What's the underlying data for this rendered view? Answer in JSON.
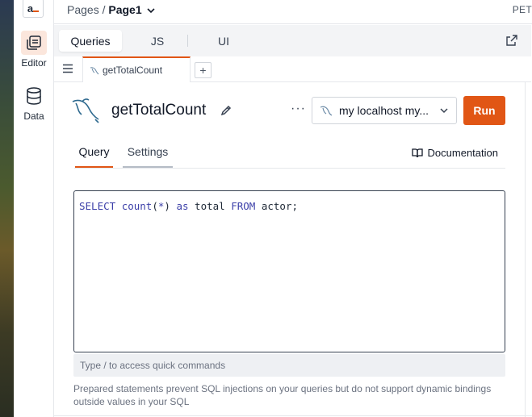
{
  "header": {
    "logo_text": "a",
    "breadcrumb_root": "Pages",
    "breadcrumb_sep": "/",
    "breadcrumb_current": "Page1",
    "app_name_partial": "PET"
  },
  "sidebar": {
    "items": [
      {
        "label": "Editor",
        "icon": "editor-icon",
        "active": true
      },
      {
        "label": "Data",
        "icon": "database-icon",
        "active": false
      }
    ]
  },
  "segmented_tabs": [
    {
      "label": "Queries",
      "active": true
    },
    {
      "label": "JS",
      "active": false
    },
    {
      "label": "UI",
      "active": false
    }
  ],
  "file_tabs": {
    "open": [
      {
        "label": "getTotalCount",
        "icon": "mysql-icon"
      }
    ],
    "add_label": "+"
  },
  "query": {
    "name": "getTotalCount",
    "more_label": "···",
    "datasource": "my localhost my...",
    "run_label": "Run"
  },
  "sub_tabs": [
    {
      "label": "Query",
      "active": true
    },
    {
      "label": "Settings",
      "active": false
    }
  ],
  "documentation_label": "Documentation",
  "editor": {
    "tokens": {
      "kw_select": "SELECT",
      "fn_count": "count",
      "paren_open": "(",
      "star": "*",
      "paren_close": ")",
      "kw_as": "as",
      "alias": "total",
      "kw_from": "FROM",
      "table": "actor",
      "semicolon": ";"
    }
  },
  "hint_text": "Type / to access quick commands",
  "note_text": "Prepared statements prevent SQL injections on your queries but do not support dynamic bindings outside values in your SQL",
  "colors": {
    "accent": "#e15615",
    "keyword": "#3b3fa8"
  }
}
